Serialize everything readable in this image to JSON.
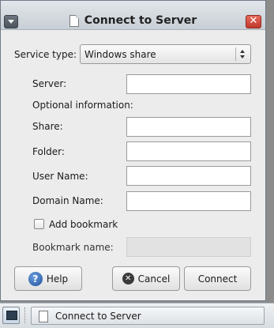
{
  "window": {
    "title": "Connect to Server",
    "close_glyph": "✕"
  },
  "form": {
    "service_type_label": "Service type:",
    "service_type_value": "Windows share",
    "server_label": "Server:",
    "server_value": "",
    "optional_info_label": "Optional information:",
    "share_label": "Share:",
    "share_value": "",
    "folder_label": "Folder:",
    "folder_value": "",
    "username_label": "User Name:",
    "username_value": "",
    "domain_label": "Domain Name:",
    "domain_value": "",
    "add_bookmark_label": "Add bookmark",
    "add_bookmark_checked": false,
    "bookmark_name_label": "Bookmark name:",
    "bookmark_name_value": ""
  },
  "buttons": {
    "help_label": "Help",
    "cancel_label": "Cancel",
    "connect_label": "Connect"
  },
  "icons": {
    "window_menu": "window-menu-icon",
    "document": "document-icon",
    "close": "close-icon",
    "help": "help-icon",
    "cancel": "cancel-icon",
    "show_desktop": "show-desktop-icon"
  },
  "taskbar": {
    "task_label": "Connect to Server"
  },
  "colors": {
    "close_button": "#c0392b",
    "help_icon": "#1f4f9a"
  }
}
